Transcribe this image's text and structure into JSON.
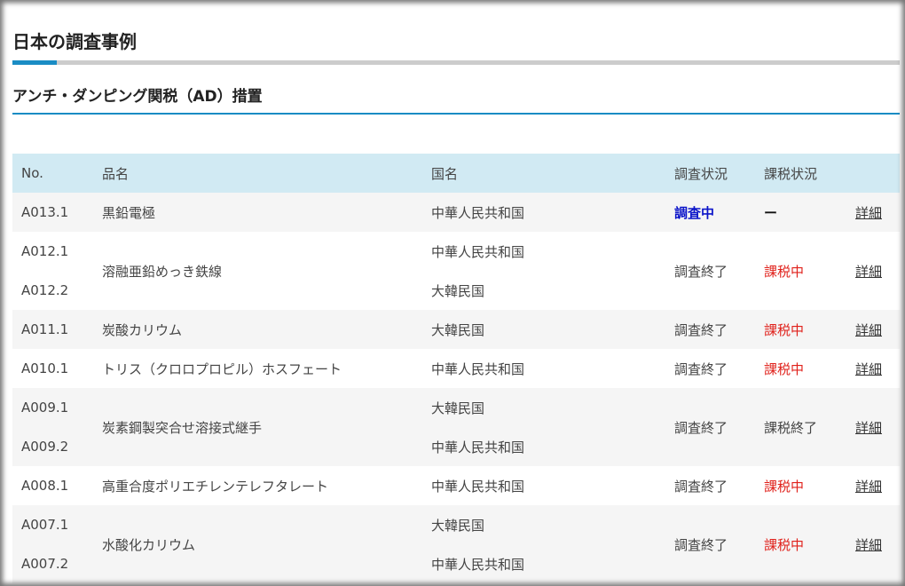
{
  "page": {
    "title": "日本の調査事例",
    "section_title": "アンチ・ダンピング関税（AD）措置"
  },
  "table": {
    "headers": {
      "no": "No.",
      "product": "品名",
      "country": "国名",
      "investigation": "調査状況",
      "taxation": "課税状況"
    },
    "detail_label": "詳細",
    "rows": [
      {
        "nos": [
          "A013.1"
        ],
        "product": "黒鉛電極",
        "countries": [
          "中華人民共和国"
        ],
        "investigation": "調査中",
        "taxation": "ー"
      },
      {
        "nos": [
          "A012.1",
          "A012.2"
        ],
        "product": "溶融亜鉛めっき鉄線",
        "countries": [
          "中華人民共和国",
          "大韓民国"
        ],
        "investigation": "調査終了",
        "taxation": "課税中"
      },
      {
        "nos": [
          "A011.1"
        ],
        "product": "炭酸カリウム",
        "countries": [
          "大韓民国"
        ],
        "investigation": "調査終了",
        "taxation": "課税中"
      },
      {
        "nos": [
          "A010.1"
        ],
        "product": "トリス（クロロプロピル）ホスフェート",
        "countries": [
          "中華人民共和国"
        ],
        "investigation": "調査終了",
        "taxation": "課税中"
      },
      {
        "nos": [
          "A009.1",
          "A009.2"
        ],
        "product": "炭素鋼製突合せ溶接式継手",
        "countries": [
          "大韓民国",
          "中華人民共和国"
        ],
        "investigation": "調査終了",
        "taxation": "課税終了"
      },
      {
        "nos": [
          "A008.1"
        ],
        "product": "高重合度ポリエチレンテレフタレート",
        "countries": [
          "中華人民共和国"
        ],
        "investigation": "調査終了",
        "taxation": "課税中"
      },
      {
        "nos": [
          "A007.1",
          "A007.2"
        ],
        "product": "水酸化カリウム",
        "countries": [
          "大韓民国",
          "中華人民共和国"
        ],
        "investigation": "調査終了",
        "taxation": "課税中"
      }
    ]
  },
  "colors": {
    "accent": "#1a8cc4",
    "header_bg": "#d1eaf3",
    "investigating": "#0b14c9",
    "taxing": "#e0211b"
  }
}
